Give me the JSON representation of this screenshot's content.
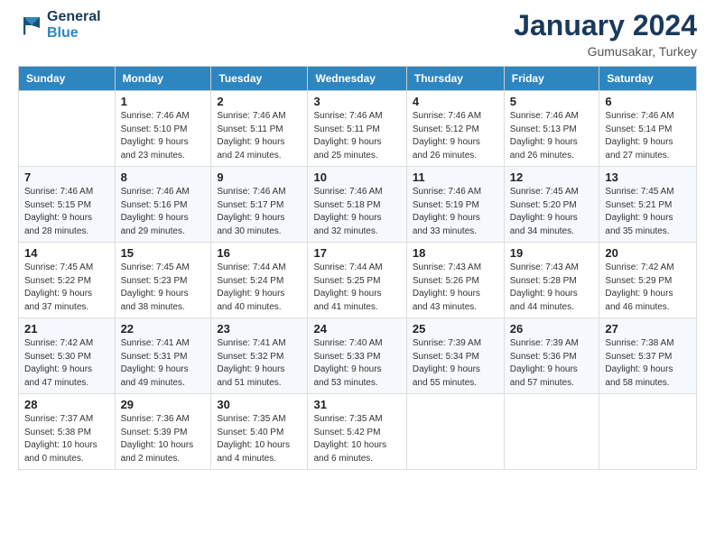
{
  "header": {
    "logo_line1": "General",
    "logo_line2": "Blue",
    "month": "January 2024",
    "location": "Gumusakar, Turkey"
  },
  "days_of_week": [
    "Sunday",
    "Monday",
    "Tuesday",
    "Wednesday",
    "Thursday",
    "Friday",
    "Saturday"
  ],
  "weeks": [
    [
      {
        "day": "",
        "info": ""
      },
      {
        "day": "1",
        "info": "Sunrise: 7:46 AM\nSunset: 5:10 PM\nDaylight: 9 hours\nand 23 minutes."
      },
      {
        "day": "2",
        "info": "Sunrise: 7:46 AM\nSunset: 5:11 PM\nDaylight: 9 hours\nand 24 minutes."
      },
      {
        "day": "3",
        "info": "Sunrise: 7:46 AM\nSunset: 5:11 PM\nDaylight: 9 hours\nand 25 minutes."
      },
      {
        "day": "4",
        "info": "Sunrise: 7:46 AM\nSunset: 5:12 PM\nDaylight: 9 hours\nand 26 minutes."
      },
      {
        "day": "5",
        "info": "Sunrise: 7:46 AM\nSunset: 5:13 PM\nDaylight: 9 hours\nand 26 minutes."
      },
      {
        "day": "6",
        "info": "Sunrise: 7:46 AM\nSunset: 5:14 PM\nDaylight: 9 hours\nand 27 minutes."
      }
    ],
    [
      {
        "day": "7",
        "info": "Sunrise: 7:46 AM\nSunset: 5:15 PM\nDaylight: 9 hours\nand 28 minutes."
      },
      {
        "day": "8",
        "info": "Sunrise: 7:46 AM\nSunset: 5:16 PM\nDaylight: 9 hours\nand 29 minutes."
      },
      {
        "day": "9",
        "info": "Sunrise: 7:46 AM\nSunset: 5:17 PM\nDaylight: 9 hours\nand 30 minutes."
      },
      {
        "day": "10",
        "info": "Sunrise: 7:46 AM\nSunset: 5:18 PM\nDaylight: 9 hours\nand 32 minutes."
      },
      {
        "day": "11",
        "info": "Sunrise: 7:46 AM\nSunset: 5:19 PM\nDaylight: 9 hours\nand 33 minutes."
      },
      {
        "day": "12",
        "info": "Sunrise: 7:45 AM\nSunset: 5:20 PM\nDaylight: 9 hours\nand 34 minutes."
      },
      {
        "day": "13",
        "info": "Sunrise: 7:45 AM\nSunset: 5:21 PM\nDaylight: 9 hours\nand 35 minutes."
      }
    ],
    [
      {
        "day": "14",
        "info": "Sunrise: 7:45 AM\nSunset: 5:22 PM\nDaylight: 9 hours\nand 37 minutes."
      },
      {
        "day": "15",
        "info": "Sunrise: 7:45 AM\nSunset: 5:23 PM\nDaylight: 9 hours\nand 38 minutes."
      },
      {
        "day": "16",
        "info": "Sunrise: 7:44 AM\nSunset: 5:24 PM\nDaylight: 9 hours\nand 40 minutes."
      },
      {
        "day": "17",
        "info": "Sunrise: 7:44 AM\nSunset: 5:25 PM\nDaylight: 9 hours\nand 41 minutes."
      },
      {
        "day": "18",
        "info": "Sunrise: 7:43 AM\nSunset: 5:26 PM\nDaylight: 9 hours\nand 43 minutes."
      },
      {
        "day": "19",
        "info": "Sunrise: 7:43 AM\nSunset: 5:28 PM\nDaylight: 9 hours\nand 44 minutes."
      },
      {
        "day": "20",
        "info": "Sunrise: 7:42 AM\nSunset: 5:29 PM\nDaylight: 9 hours\nand 46 minutes."
      }
    ],
    [
      {
        "day": "21",
        "info": "Sunrise: 7:42 AM\nSunset: 5:30 PM\nDaylight: 9 hours\nand 47 minutes."
      },
      {
        "day": "22",
        "info": "Sunrise: 7:41 AM\nSunset: 5:31 PM\nDaylight: 9 hours\nand 49 minutes."
      },
      {
        "day": "23",
        "info": "Sunrise: 7:41 AM\nSunset: 5:32 PM\nDaylight: 9 hours\nand 51 minutes."
      },
      {
        "day": "24",
        "info": "Sunrise: 7:40 AM\nSunset: 5:33 PM\nDaylight: 9 hours\nand 53 minutes."
      },
      {
        "day": "25",
        "info": "Sunrise: 7:39 AM\nSunset: 5:34 PM\nDaylight: 9 hours\nand 55 minutes."
      },
      {
        "day": "26",
        "info": "Sunrise: 7:39 AM\nSunset: 5:36 PM\nDaylight: 9 hours\nand 57 minutes."
      },
      {
        "day": "27",
        "info": "Sunrise: 7:38 AM\nSunset: 5:37 PM\nDaylight: 9 hours\nand 58 minutes."
      }
    ],
    [
      {
        "day": "28",
        "info": "Sunrise: 7:37 AM\nSunset: 5:38 PM\nDaylight: 10 hours\nand 0 minutes."
      },
      {
        "day": "29",
        "info": "Sunrise: 7:36 AM\nSunset: 5:39 PM\nDaylight: 10 hours\nand 2 minutes."
      },
      {
        "day": "30",
        "info": "Sunrise: 7:35 AM\nSunset: 5:40 PM\nDaylight: 10 hours\nand 4 minutes."
      },
      {
        "day": "31",
        "info": "Sunrise: 7:35 AM\nSunset: 5:42 PM\nDaylight: 10 hours\nand 6 minutes."
      },
      {
        "day": "",
        "info": ""
      },
      {
        "day": "",
        "info": ""
      },
      {
        "day": "",
        "info": ""
      }
    ]
  ]
}
